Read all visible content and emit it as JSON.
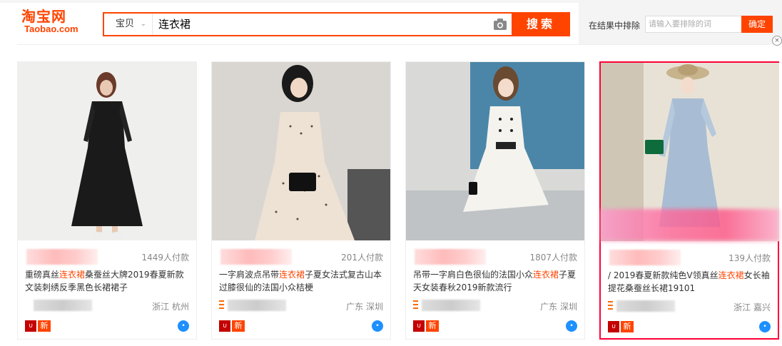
{
  "header": {
    "logo_cn": "淘宝网",
    "logo_en": "Taobao.com",
    "search_type": "宝贝",
    "search_query": "连衣裙",
    "search_button": "搜索",
    "exclude_label": "在结果中排除",
    "exclude_placeholder": "请输入要排除的词",
    "exclude_button": "确定"
  },
  "colors": {
    "accent": "#ff4400",
    "highlight": "#ff0036"
  },
  "products": [
    {
      "sales": "1449人付款",
      "title_pre": "重磅真丝",
      "keyword": "连衣裙",
      "title_post": "桑蚕丝大牌2019春夏新款文装刺绣反季黑色长裙裙子",
      "location": "浙江 杭州",
      "tag_new": "新"
    },
    {
      "sales": "201人付款",
      "title_pre": "一字肩波点吊带",
      "keyword": "连衣裙",
      "title_post": "子夏女法式复古山本过膝很仙的法国小众桔梗",
      "location": "广东 深圳",
      "tag_new": "新"
    },
    {
      "sales": "1807人付款",
      "title_pre": "吊带一字肩白色很仙的法国小众",
      "keyword": "连衣裙",
      "title_post": "子夏天女装春秋2019新款流行",
      "location": "广东 深圳",
      "tag_new": "新"
    },
    {
      "sales": "139人付款",
      "title_pre": "/ 2019春夏新款纯色V领真丝",
      "keyword": "连衣裙",
      "title_post": "女长袖提花桑蚕丝长裙19101",
      "location": "浙江 嘉兴",
      "tag_new": "新"
    }
  ]
}
